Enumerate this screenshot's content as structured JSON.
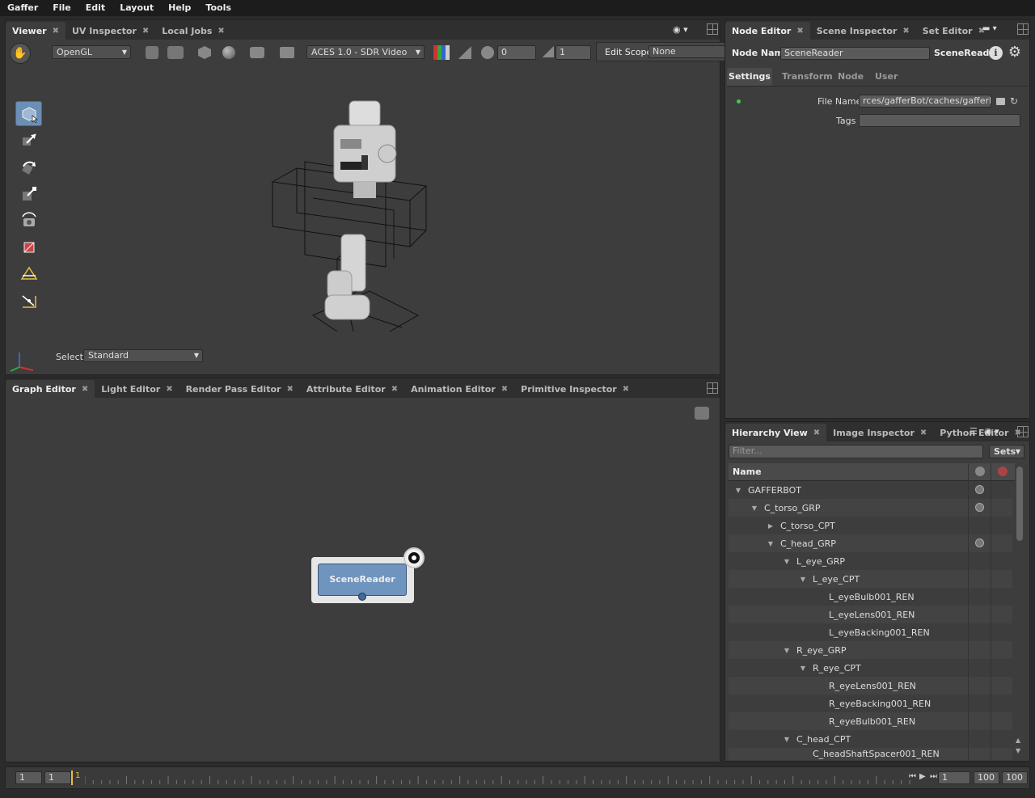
{
  "menubar": [
    "Gaffer",
    "File",
    "Edit",
    "Layout",
    "Help",
    "Tools"
  ],
  "viewer_panel": {
    "tabs": [
      "Viewer",
      "UV Inspector",
      "Local Jobs"
    ],
    "renderer": "OpenGL",
    "display_transform": "ACES 1.0 - SDR Video",
    "exposure": "0",
    "gamma": "1",
    "edit_scope_label": "Edit Scope",
    "edit_scope_value": "None",
    "select_label": "Select",
    "select_value": "Standard"
  },
  "graph_panel": {
    "tabs": [
      "Graph Editor",
      "Light Editor",
      "Render Pass Editor",
      "Attribute Editor",
      "Animation Editor",
      "Primitive Inspector"
    ],
    "node_label": "SceneReader"
  },
  "node_editor": {
    "tabs": [
      "Node Editor",
      "Scene Inspector",
      "Set Editor"
    ],
    "node_name_label": "Node Name",
    "node_name_value": "SceneReader",
    "node_type": "SceneReader",
    "sections": [
      "Settings",
      "Transform",
      "Node",
      "User"
    ],
    "file_name_label": "File Name",
    "file_name_value": "rces/gafferBot/caches/gafferBot.scc",
    "tags_label": "Tags",
    "tags_value": ""
  },
  "hierarchy": {
    "tabs": [
      "Hierarchy View",
      "Image Inspector",
      "Python Editor"
    ],
    "filter_placeholder": "Filter...",
    "sets_label": "Sets",
    "name_header": "Name",
    "rows": [
      {
        "label": "GAFFERBOT",
        "depth": 0,
        "tri": "▼",
        "vis": true
      },
      {
        "label": "C_torso_GRP",
        "depth": 1,
        "tri": "▼",
        "vis": true
      },
      {
        "label": "C_torso_CPT",
        "depth": 2,
        "tri": "▶",
        "vis": false
      },
      {
        "label": "C_head_GRP",
        "depth": 2,
        "tri": "▼",
        "vis": true
      },
      {
        "label": "L_eye_GRP",
        "depth": 3,
        "tri": "▼",
        "vis": false
      },
      {
        "label": "L_eye_CPT",
        "depth": 4,
        "tri": "▼",
        "vis": false
      },
      {
        "label": "L_eyeBulb001_REN",
        "depth": 5,
        "tri": "",
        "vis": false
      },
      {
        "label": "L_eyeLens001_REN",
        "depth": 5,
        "tri": "",
        "vis": false
      },
      {
        "label": "L_eyeBacking001_REN",
        "depth": 5,
        "tri": "",
        "vis": false
      },
      {
        "label": "R_eye_GRP",
        "depth": 3,
        "tri": "▼",
        "vis": false
      },
      {
        "label": "R_eye_CPT",
        "depth": 4,
        "tri": "▼",
        "vis": false
      },
      {
        "label": "R_eyeLens001_REN",
        "depth": 5,
        "tri": "",
        "vis": false
      },
      {
        "label": "R_eyeBacking001_REN",
        "depth": 5,
        "tri": "",
        "vis": false
      },
      {
        "label": "R_eyeBulb001_REN",
        "depth": 5,
        "tri": "",
        "vis": false
      },
      {
        "label": "C_head_CPT",
        "depth": 3,
        "tri": "▼",
        "vis": false
      },
      {
        "label": "C_headShaftSpacer001_REN",
        "depth": 4,
        "tri": "",
        "vis": false
      }
    ]
  },
  "timeline": {
    "start": "1",
    "current_start": "1",
    "playhead": "1",
    "frame": "1",
    "end": "100",
    "range_end": "100"
  }
}
